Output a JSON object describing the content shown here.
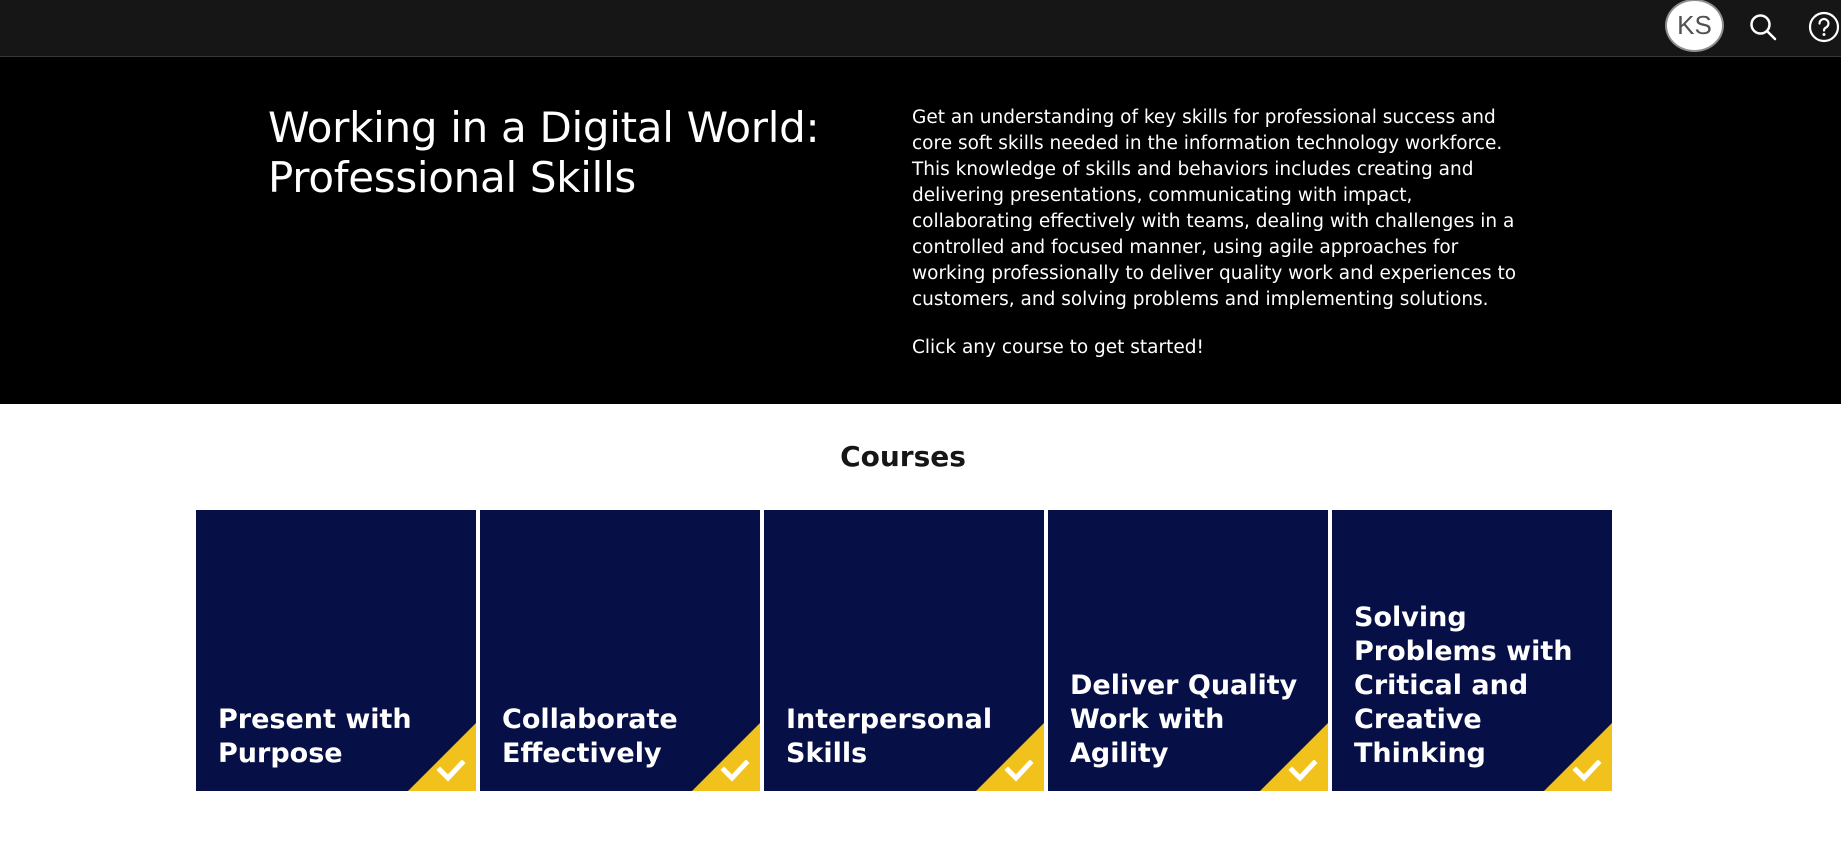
{
  "header": {
    "avatar_initials": "KS",
    "icons": [
      "user-avatar",
      "search-icon",
      "help-icon"
    ]
  },
  "hero": {
    "title": "Working in a Digital World: Professional Skills",
    "description": "Get an understanding of key skills for professional success and core soft skills needed in the information technology workforce. This knowledge of skills and behaviors includes creating and delivering presentations, communicating with impact, collaborating effectively with teams, dealing with challenges in a controlled and focused manner, using agile approaches for working professionally to deliver quality work and experiences to customers, and solving problems and implementing solutions.",
    "cta_text": "Click any course to get started!"
  },
  "courses": {
    "heading": "Courses",
    "items": [
      {
        "title": "Present with Purpose",
        "status": "completed"
      },
      {
        "title": "Collaborate Effectively",
        "status": "completed"
      },
      {
        "title": "Interpersonal Skills",
        "status": "completed"
      },
      {
        "title": "Deliver Quality Work with Agility",
        "status": "completed"
      },
      {
        "title": "Solving Problems with Critical and Creative Thinking",
        "status": "completed"
      }
    ]
  },
  "colors": {
    "topbar": "#161616",
    "hero_bg": "#000000",
    "card_bg": "#061046",
    "badge": "#f1c21b"
  }
}
